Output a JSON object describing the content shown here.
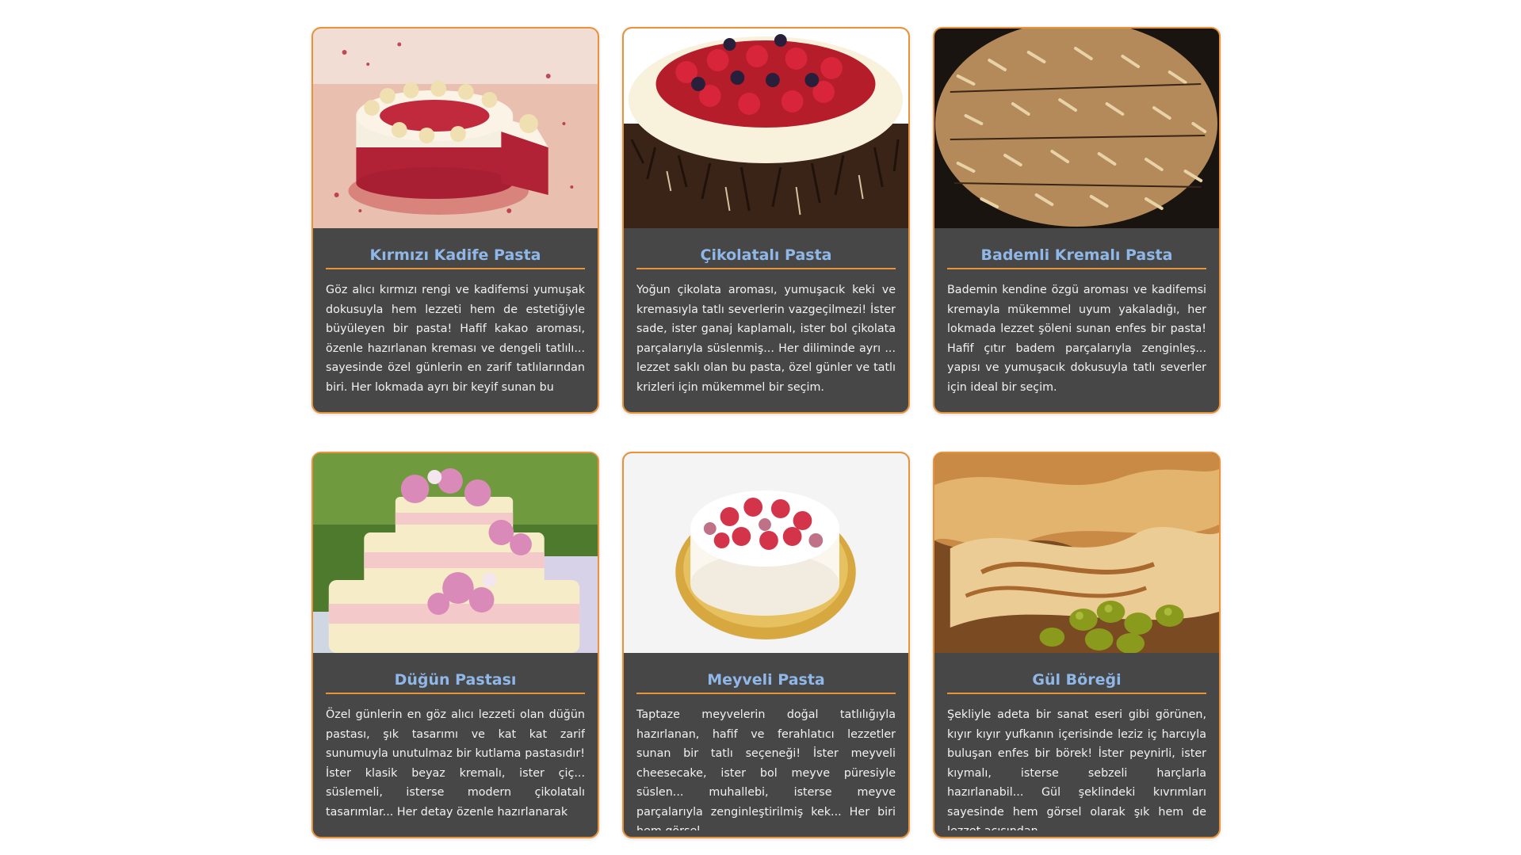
{
  "cards": [
    {
      "title": "Kırmızı Kadife Pasta",
      "image_icon": "red-velvet-cake-photo",
      "text": "Göz alıcı kırmızı rengi ve kadifemsi yumuşak dokusuyla hem lezzeti hem de estetiğiyle büyüleyen bir pasta! Hafif kakao aroması, özenle hazırlanan kreması ve dengeli tatlılı... sayesinde özel günlerin en zarif tatlılarından biri. Her lokmada ayrı bir keyif sunan bu"
    },
    {
      "title": "Çikolatalı Pasta",
      "image_icon": "chocolate-cake-photo",
      "text": "Yoğun çikolata aroması, yumuşacık keki ve kremasıyla tatlı severlerin vazgeçilmezi! İster sade, ister ganaj kaplamalı, ister bol çikolata parçalarıyla süslenmiş... Her diliminde ayrı ... lezzet saklı olan bu pasta, özel günler ve tatlı krizleri için mükemmel bir seçim."
    },
    {
      "title": "Bademli Kremalı Pasta",
      "image_icon": "almond-cream-cake-photo",
      "text": "Bademin kendine özgü aroması ve kadifemsi kremayla mükemmel uyum yakaladığı, her lokmada lezzet şöleni sunan enfes bir pasta! Hafif çıtır badem parçalarıyla zenginleş... yapısı ve yumuşacık dokusuyla tatlı severler için ideal bir seçim."
    },
    {
      "title": "Düğün Pastası",
      "image_icon": "wedding-cake-photo",
      "text": "Özel günlerin en göz alıcı lezzeti olan düğün pastası, şık tasarımı ve kat kat zarif sunumuyla unutulmaz bir kutlama pastasıdır! İster klasik beyaz kremalı, ister çiç... süslemeli, isterse modern çikolatalı tasarımlar... Her detay özenle hazırlanarak"
    },
    {
      "title": "Meyveli Pasta",
      "image_icon": "fruit-cake-photo",
      "text": "Taptaze meyvelerin doğal tatlılığıyla hazırlanan, hafif ve ferahlatıcı lezzetler sunan bir tatlı seçeneği! İster meyveli cheesecake, ister bol meyve püresiyle süslen... muhallebi, isterse meyve parçalarıyla zenginleştirilmiş kek... Her biri hem görsel"
    },
    {
      "title": "Gül Böreği",
      "image_icon": "rose-borek-photo",
      "text": "Şekliyle adeta bir sanat eseri gibi görünen, kıyır kıyır yufkanın içerisinde leziz iç harcıyla buluşan enfes bir börek! İster peynirli, ister kıymalı, isterse sebzeli harçlarla hazırlanabil... Gül şeklindeki kıvrımları sayesinde hem görsel olarak şık hem de lezzet açısından"
    }
  ],
  "colors": {
    "card_bg": "#474747",
    "card_border": "#e8923a",
    "title": "#8fb7e8",
    "text": "#f2f2f2"
  }
}
